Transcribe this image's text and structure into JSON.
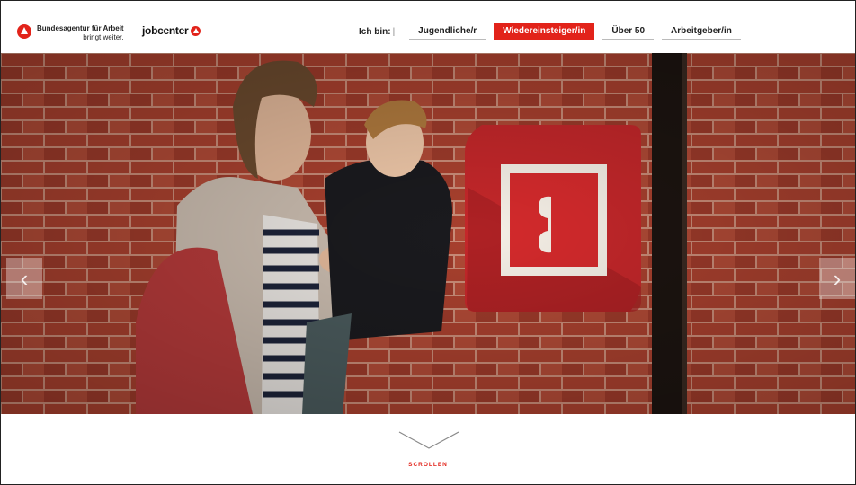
{
  "header": {
    "ba_name": "Bundesagentur für Arbeit",
    "ba_claim": "bringt weiter.",
    "jobcenter": "jobcenter"
  },
  "nav": {
    "label": "Ich bin:",
    "separator": "|",
    "items": [
      {
        "label": "Jugendliche/r",
        "active": false
      },
      {
        "label": "Wiedereinsteiger/in",
        "active": true
      },
      {
        "label": "Über 50",
        "active": false
      },
      {
        "label": "Arbeitgeber/in",
        "active": false
      }
    ]
  },
  "slider": {
    "prev": "‹",
    "next": "›"
  },
  "scroll": {
    "label": "SCROLLEN"
  },
  "colors": {
    "accent": "#e2231a",
    "brick": "#a8402e",
    "mortar": "#c98c78"
  },
  "icons": [
    "ba-logo-icon",
    "jobcenter-logo-icon",
    "chevron-left-icon",
    "chevron-right-icon",
    "chevron-down-icon",
    "puzzle-sign-icon"
  ]
}
